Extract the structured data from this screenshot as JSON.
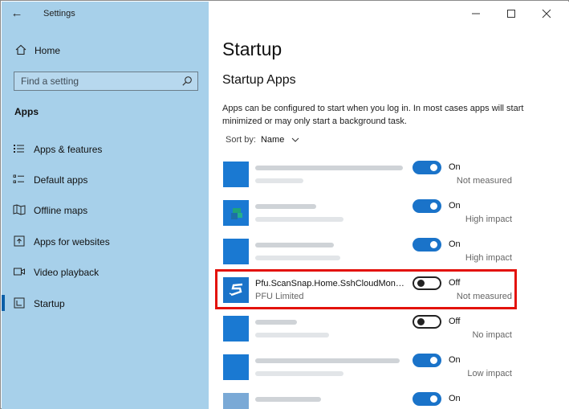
{
  "window": {
    "title": "Settings",
    "back_glyph": "←",
    "minimize_glyph": "—",
    "maximize_glyph": "☐",
    "close_glyph": "✕"
  },
  "sidebar": {
    "home_label": "Home",
    "search_placeholder": "Find a setting",
    "section_title": "Apps",
    "items": [
      {
        "label": "Apps & features",
        "icon": "list-icon"
      },
      {
        "label": "Default apps",
        "icon": "default-apps-icon"
      },
      {
        "label": "Offline maps",
        "icon": "map-icon"
      },
      {
        "label": "Apps for websites",
        "icon": "open-in-browser-icon"
      },
      {
        "label": "Video playback",
        "icon": "video-icon"
      },
      {
        "label": "Startup",
        "icon": "startup-icon",
        "active": true
      }
    ]
  },
  "main": {
    "title": "Startup",
    "subtitle": "Startup Apps",
    "description": "Apps can be configured to start when you log in. In most cases apps will start minimized or may only start a background task.",
    "sort": {
      "label": "Sort by:",
      "value": "Name"
    },
    "apps": [
      {
        "name": "",
        "publisher": "",
        "toggle": "On",
        "impact": "Not measured"
      },
      {
        "name": "",
        "publisher": "",
        "toggle": "On",
        "impact": "High impact"
      },
      {
        "name": "",
        "publisher": "",
        "toggle": "On",
        "impact": "High impact"
      },
      {
        "name": "Pfu.ScanSnap.Home.SshCloudMonit...",
        "publisher": "PFU Limited",
        "toggle": "Off",
        "impact": "Not measured"
      },
      {
        "name": "",
        "publisher": "",
        "toggle": "Off",
        "impact": "No impact"
      },
      {
        "name": "",
        "publisher": "",
        "toggle": "On",
        "impact": "Low impact"
      },
      {
        "name": "",
        "publisher": "",
        "toggle": "On",
        "impact": ""
      }
    ]
  },
  "colors": {
    "sidebar_bg": "#a7d0ea",
    "accent": "#1a73c9",
    "highlight": "#e3120b"
  }
}
